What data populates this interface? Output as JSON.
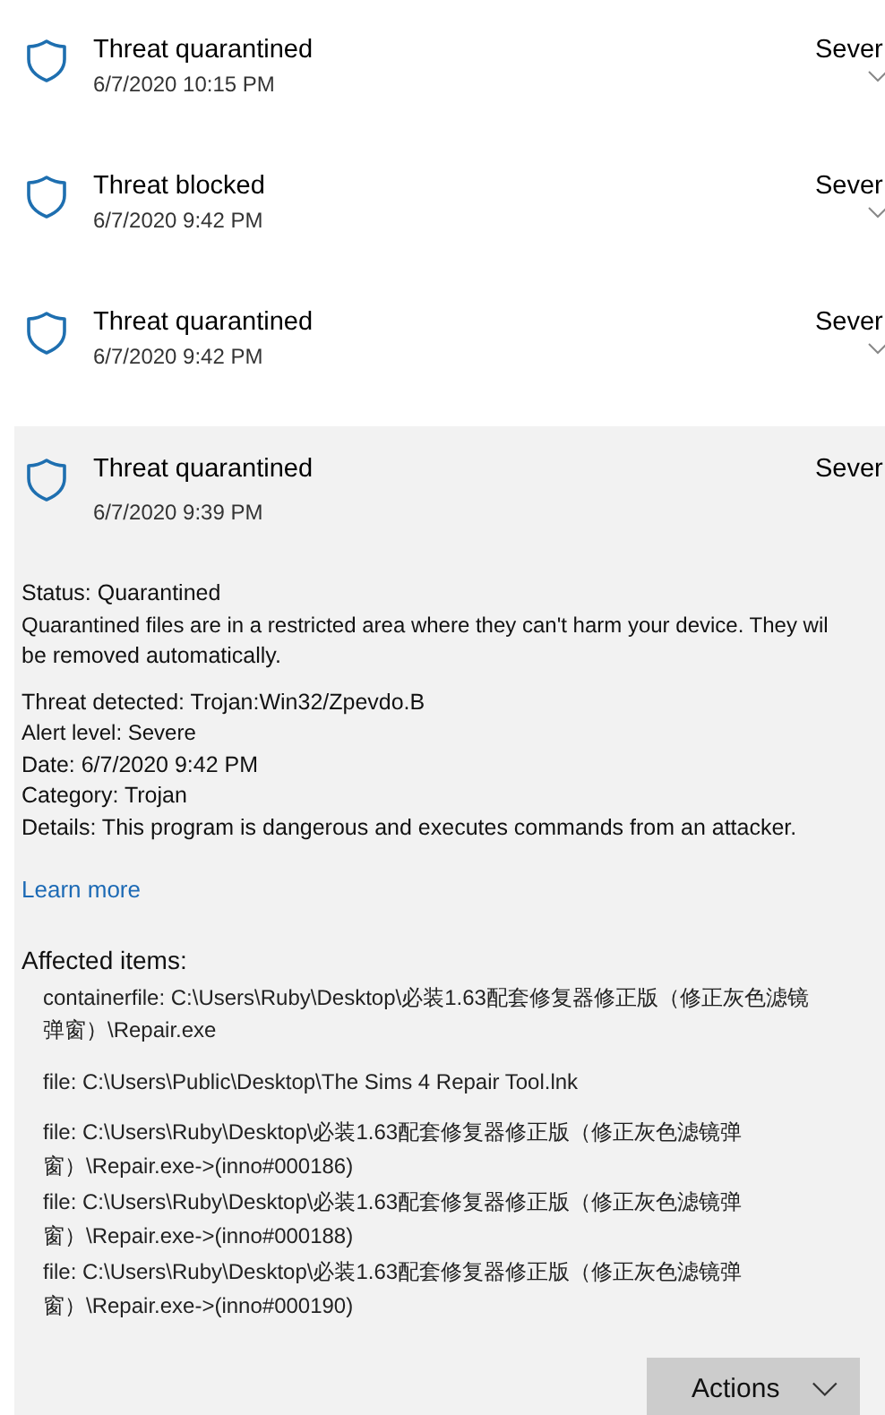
{
  "threats": [
    {
      "title": "Threat quarantined",
      "date": "6/7/2020 10:15 PM",
      "severity": "Sever",
      "expanded": false
    },
    {
      "title": "Threat blocked",
      "date": "6/7/2020 9:42 PM",
      "severity": "Sever",
      "expanded": false
    },
    {
      "title": "Threat quarantined",
      "date": "6/7/2020 9:42 PM",
      "severity": "Sever",
      "expanded": false
    },
    {
      "title": "Threat quarantined",
      "date": "6/7/2020 9:39 PM",
      "severity": "Sever",
      "expanded": true,
      "details": {
        "status": "Status:  Quarantined",
        "status_text": [
          "Quarantined files are in a restricted area where they can't harm your device. They wil",
          "be removed automatically."
        ],
        "fields": [
          "Threat detected:  Trojan:Win32/Zpevdo.B",
          "Alert level: Severe",
          "Date:  6/7/2020 9:42 PM",
          "Category:  Trojan",
          "Details:  This program is dangerous and executes commands from an attacker."
        ],
        "link": "Learn more",
        "affected_heading": "Affected items:",
        "affected_items": [
          [
            "containerfile: C:\\Users\\Ruby\\Desktop\\必装1.63配套修复器修正版（修正灰色滤镜",
            "弹窗）\\Repair.exe"
          ],
          [
            "file: C:\\Users\\Public\\Desktop\\The Sims 4 Repair Tool.lnk"
          ],
          [
            "file: C:\\Users\\Ruby\\Desktop\\必装1.63配套修复器修正版（修正灰色滤镜弹",
            "窗）\\Repair.exe->(inno#000186)"
          ],
          [
            "file: C:\\Users\\Ruby\\Desktop\\必装1.63配套修复器修正版（修正灰色滤镜弹",
            "窗）\\Repair.exe->(inno#000188)"
          ],
          [
            "file: C:\\Users\\Ruby\\Desktop\\必装1.63配套修复器修正版（修正灰色滤镜弹",
            "窗）\\Repair.exe->(inno#000190)"
          ]
        ],
        "action_button": "Actions"
      }
    }
  ]
}
